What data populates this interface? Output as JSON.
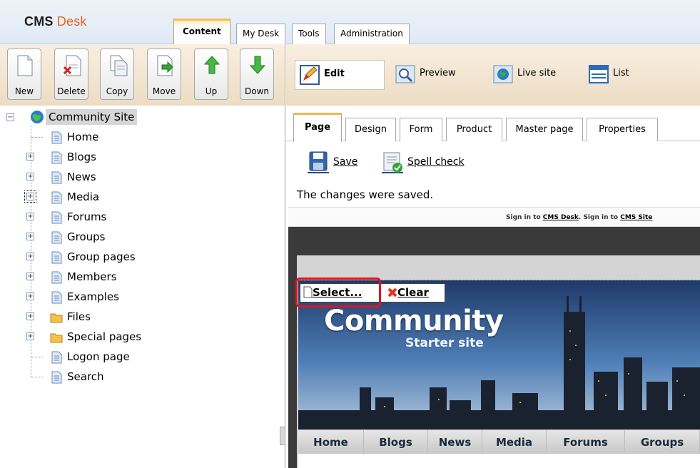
{
  "brand": {
    "cms": "CMS",
    "desk": "Desk"
  },
  "top_tabs": [
    {
      "label": "Content",
      "active": true
    },
    {
      "label": "My Desk",
      "active": false
    },
    {
      "label": "Tools",
      "active": false
    },
    {
      "label": "Administration",
      "active": false
    }
  ],
  "left_toolbar": [
    {
      "label": "New",
      "icon": "new-document-icon"
    },
    {
      "label": "Delete",
      "icon": "delete-document-icon"
    },
    {
      "label": "Copy",
      "icon": "copy-document-icon"
    },
    {
      "label": "Move",
      "icon": "move-document-icon"
    },
    {
      "label": "Up",
      "icon": "arrow-up-icon"
    },
    {
      "label": "Down",
      "icon": "arrow-down-icon"
    }
  ],
  "modes": [
    {
      "label": "Edit",
      "icon": "edit-pencil-icon",
      "active": true
    },
    {
      "label": "Preview",
      "icon": "preview-magnifier-icon"
    },
    {
      "label": "Live site",
      "icon": "live-site-globe-icon"
    },
    {
      "label": "List",
      "icon": "list-icon"
    }
  ],
  "tree": {
    "root": "Community Site",
    "items": [
      {
        "label": "Home",
        "expandable": false,
        "icon": "page-icon"
      },
      {
        "label": "Blogs",
        "expandable": true,
        "icon": "page-icon"
      },
      {
        "label": "News",
        "expandable": true,
        "icon": "page-icon"
      },
      {
        "label": "Media",
        "expandable": true,
        "icon": "page-icon",
        "focused": true
      },
      {
        "label": "Forums",
        "expandable": true,
        "icon": "page-icon"
      },
      {
        "label": "Groups",
        "expandable": true,
        "icon": "page-icon"
      },
      {
        "label": "Group pages",
        "expandable": true,
        "icon": "page-icon"
      },
      {
        "label": "Members",
        "expandable": true,
        "icon": "page-icon"
      },
      {
        "label": "Examples",
        "expandable": true,
        "icon": "page-icon"
      },
      {
        "label": "Files",
        "expandable": true,
        "icon": "folder-icon"
      },
      {
        "label": "Special pages",
        "expandable": true,
        "icon": "folder-icon"
      },
      {
        "label": "Logon page",
        "expandable": false,
        "icon": "page-icon"
      },
      {
        "label": "Search",
        "expandable": false,
        "icon": "page-icon"
      }
    ]
  },
  "content_tabs": [
    {
      "label": "Page",
      "active": true
    },
    {
      "label": "Design"
    },
    {
      "label": "Form"
    },
    {
      "label": "Product"
    },
    {
      "label": "Master page"
    },
    {
      "label": "Properties"
    }
  ],
  "actions": {
    "save": "Save",
    "spell_check": "Spell check"
  },
  "message": "The changes were saved.",
  "signin": {
    "prefix": "Sign in to ",
    "cms_desk": "CMS Desk",
    "middle": ". Sign in to ",
    "cms_site": "CMS Site"
  },
  "preview": {
    "banner_title": "Community",
    "banner_subtitle": "Starter site",
    "select_label": "Select...",
    "clear_label": "Clear",
    "nav": [
      "Home",
      "Blogs",
      "News",
      "Media",
      "Forums",
      "Groups"
    ]
  },
  "colors": {
    "accent_orange": "#e8631a",
    "highlight_red": "#e0141c",
    "toolbar_bg": "#f2e6d2"
  }
}
